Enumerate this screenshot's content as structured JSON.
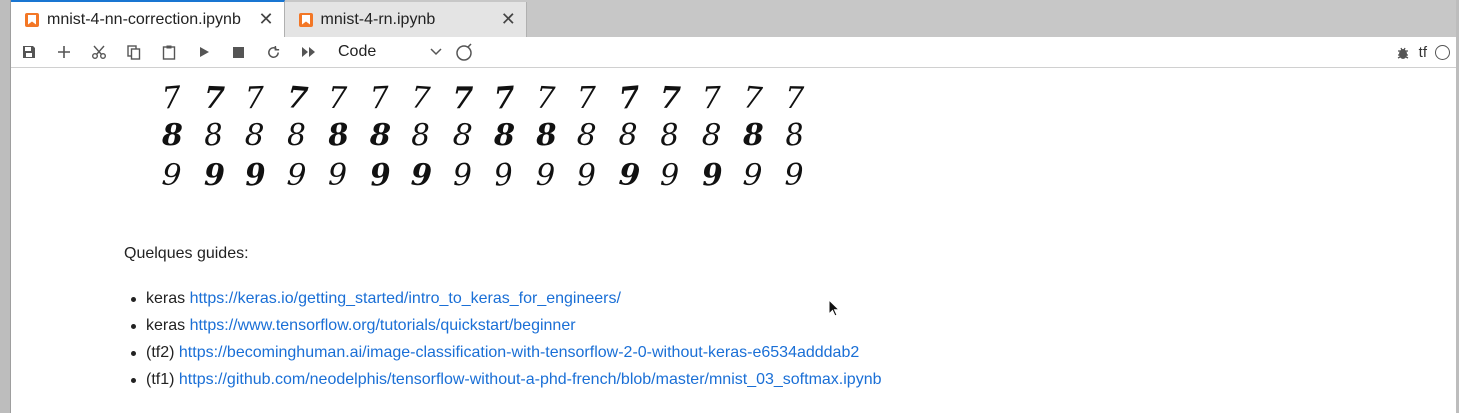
{
  "tabs": [
    {
      "label": "mnist-4-nn-correction.ipynb",
      "active": true
    },
    {
      "label": "mnist-4-rn.ipynb",
      "active": false
    }
  ],
  "toolbar": {
    "cell_type": "Code",
    "kernel_name": "tf",
    "icons": [
      "save-icon",
      "add-icon",
      "cut-icon",
      "copy-icon",
      "paste-icon",
      "run-icon",
      "stop-icon",
      "restart-icon",
      "fast-forward-icon",
      "chevron-down-icon",
      "bug-icon",
      "kernel-status-icon"
    ]
  },
  "digits": {
    "rows": [
      [
        "7",
        "7",
        "7",
        "7",
        "7",
        "7",
        "7",
        "7",
        "7",
        "7",
        "7",
        "7",
        "7",
        "7",
        "7",
        "7"
      ],
      [
        "8",
        "8",
        "8",
        "8",
        "8",
        "8",
        "8",
        "8",
        "8",
        "8",
        "8",
        "8",
        "8",
        "8",
        "8",
        "8"
      ],
      [
        "9",
        "9",
        "9",
        "9",
        "9",
        "9",
        "9",
        "9",
        "9",
        "9",
        "9",
        "9",
        "9",
        "9",
        "9",
        "9"
      ]
    ]
  },
  "markdown": {
    "guides_title": "Quelques guides:",
    "links": [
      {
        "prefix": "keras",
        "url": "https://keras.io/getting_started/intro_to_keras_for_engineers/"
      },
      {
        "prefix": "keras",
        "url": "https://www.tensorflow.org/tutorials/quickstart/beginner"
      },
      {
        "prefix": "(tf2)",
        "url": "https://becominghuman.ai/image-classification-with-tensorflow-2-0-without-keras-e6534adddab2"
      },
      {
        "prefix": "(tf1)",
        "url": "https://github.com/neodelphis/tensorflow-without-a-phd-french/blob/master/mnist_03_softmax.ipynb"
      }
    ]
  },
  "colors": {
    "accent": "#1976d2",
    "link": "#1a6fd6",
    "notebook_icon": "#f37726"
  }
}
